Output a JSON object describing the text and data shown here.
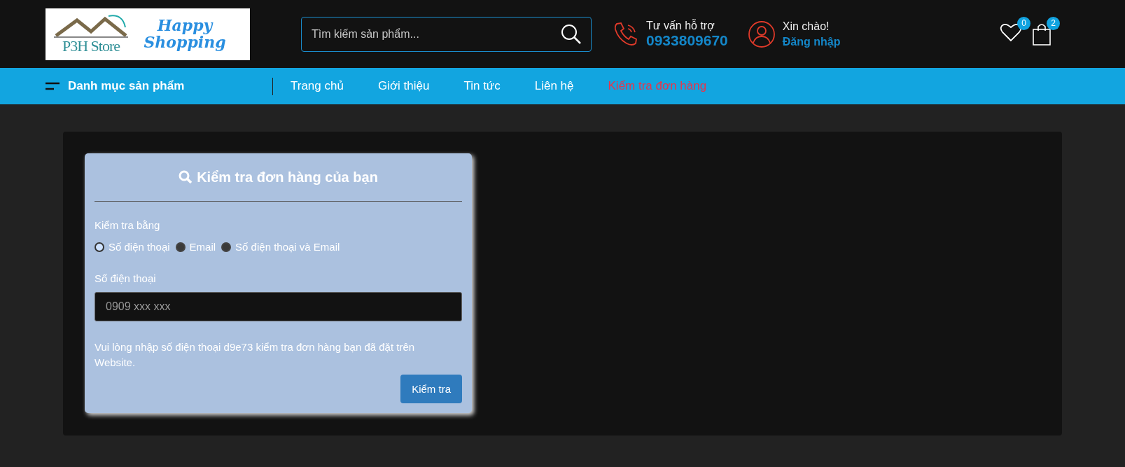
{
  "logo": {
    "brand": "P3H Store",
    "slogan": "Happy Shopping"
  },
  "search": {
    "placeholder": "Tìm kiếm sản phẩm..."
  },
  "support": {
    "label": "Tư vấn hỗ trợ",
    "phone": "0933809670"
  },
  "account": {
    "greeting": "Xin chào!",
    "login": "Đăng nhập"
  },
  "wishlist": {
    "count": "0"
  },
  "cart": {
    "count": "2"
  },
  "nav": {
    "category": "Danh mục sản phẩm",
    "items": [
      {
        "label": "Trang chủ",
        "selected": false
      },
      {
        "label": "Giới thiệu",
        "selected": false
      },
      {
        "label": "Tin tức",
        "selected": false
      },
      {
        "label": "Liên hệ",
        "selected": false
      },
      {
        "label": "Kiểm tra đơn hàng",
        "selected": true
      }
    ]
  },
  "order_check": {
    "title": "Kiểm tra đơn hàng của bạn",
    "method_label": "Kiểm tra bằng",
    "methods": [
      {
        "label": "Số điện thoại",
        "selected": true
      },
      {
        "label": "Email",
        "selected": false
      },
      {
        "label": "Số điện thoại và Email",
        "selected": false
      }
    ],
    "field_label": "Số điện thoại",
    "placeholder": "0909 xxx xxx",
    "note": "Vui lòng nhập số điện thoại d9e73 kiểm tra đơn hàng bạn đã đặt trên Website.",
    "button": "Kiểm tra"
  }
}
